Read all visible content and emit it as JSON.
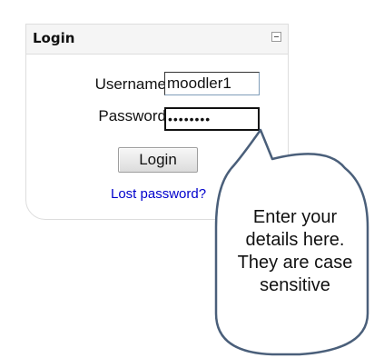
{
  "login_block": {
    "title": "Login",
    "collapse_icon": "minus-square-icon",
    "username": {
      "label": "Username",
      "value": "moodler1"
    },
    "password": {
      "label": "Password",
      "masked_value": "••••••••"
    },
    "login_button_label": "Login",
    "lost_password_link": "Lost password?"
  },
  "callout": {
    "text": "Enter your details here. They are case sensitive",
    "line_1": "Enter your",
    "line_2": "details here.",
    "line_3": "They are case",
    "line_4": "sensitive",
    "border_color": "#4a5f7a"
  },
  "colors": {
    "link": "#0000cc",
    "header_bg": "#f5f5f5",
    "border": "#dddddd"
  }
}
